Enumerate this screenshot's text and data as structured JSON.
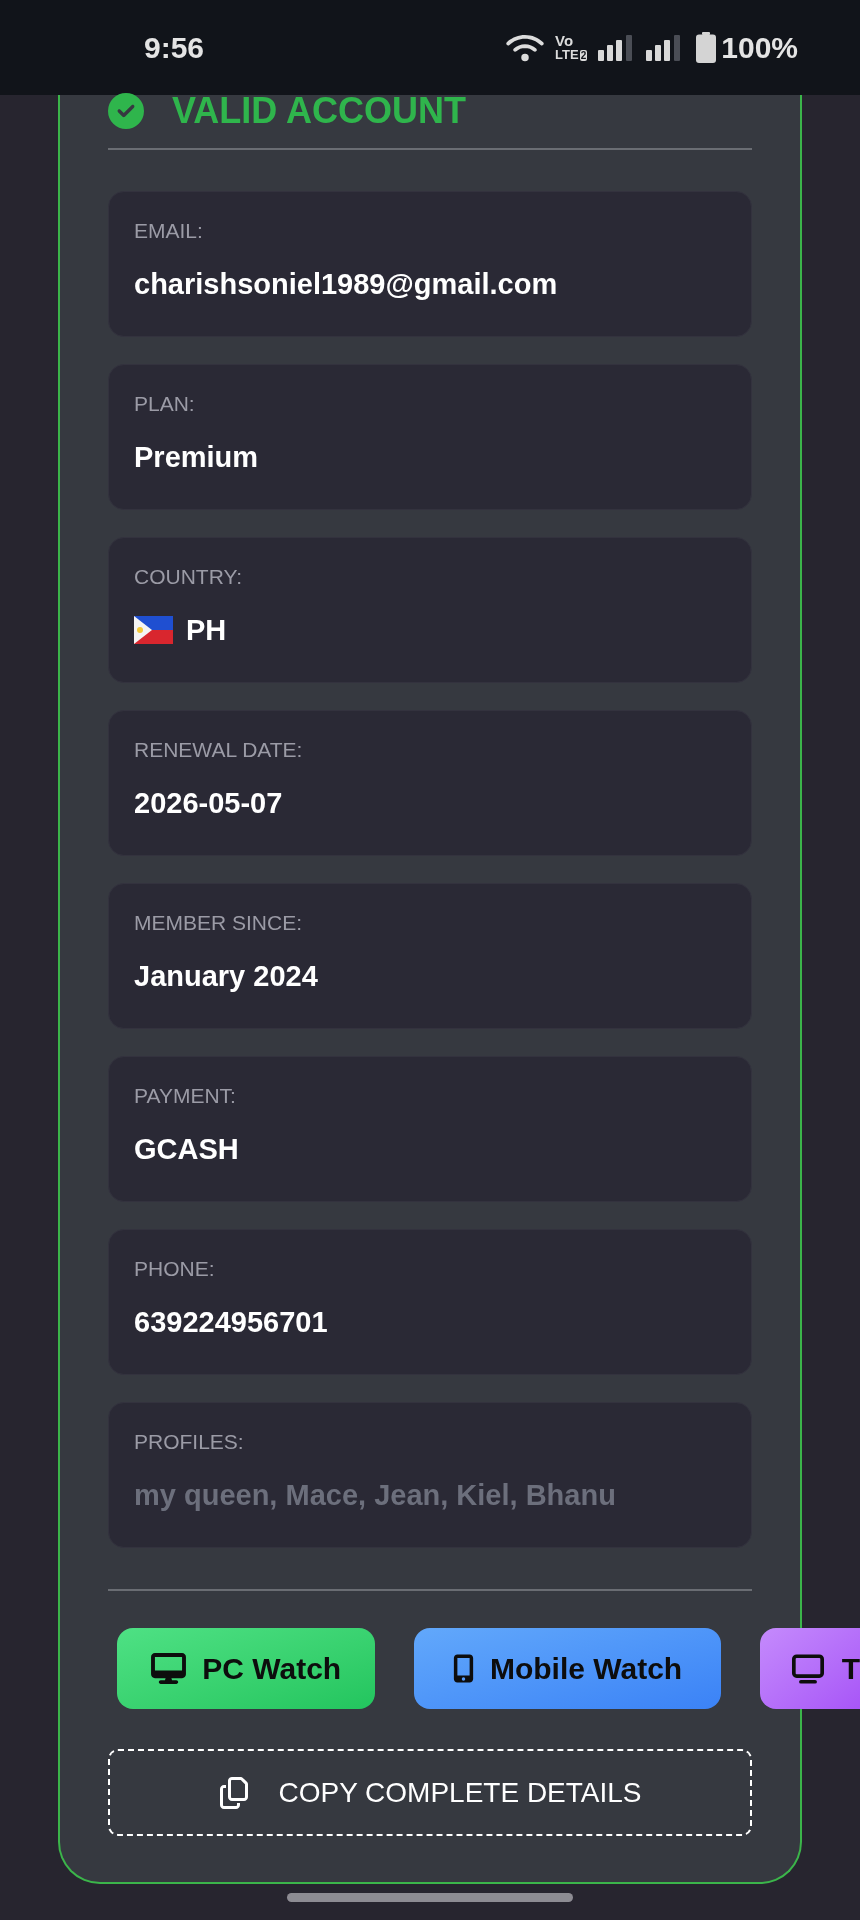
{
  "status_bar": {
    "time": "9:56",
    "volte": {
      "top": "Vo",
      "bottom": "LTE",
      "sim": "2"
    },
    "battery": "100%"
  },
  "account": {
    "status": {
      "kind": "valid",
      "label": "VALID ACCOUNT"
    },
    "fields": [
      {
        "kind": "text",
        "label": "EMAIL:",
        "value": "charishsoniel1989@gmail.com"
      },
      {
        "kind": "text",
        "label": "PLAN:",
        "value": "Premium"
      },
      {
        "kind": "country",
        "label": "COUNTRY:",
        "value": "PH"
      },
      {
        "kind": "text",
        "label": "RENEWAL DATE:",
        "value": "2026-05-07"
      },
      {
        "kind": "text",
        "label": "MEMBER SINCE:",
        "value": "January 2024"
      },
      {
        "kind": "text",
        "label": "PAYMENT:",
        "value": "GCASH"
      },
      {
        "kind": "text",
        "label": "PHONE:",
        "value": "639224956701"
      },
      {
        "kind": "list",
        "label": "PROFILES:",
        "value": "my queen, Mace, Jean, Kiel, Bhanu"
      }
    ],
    "watch_buttons": [
      {
        "kind": "pc",
        "label": "PC Watch"
      },
      {
        "kind": "mobile",
        "label": "Mobile Watch"
      },
      {
        "kind": "tv",
        "label": "T"
      }
    ],
    "copy_button": {
      "label": "COPY COMPLETE DETAILS"
    }
  }
}
